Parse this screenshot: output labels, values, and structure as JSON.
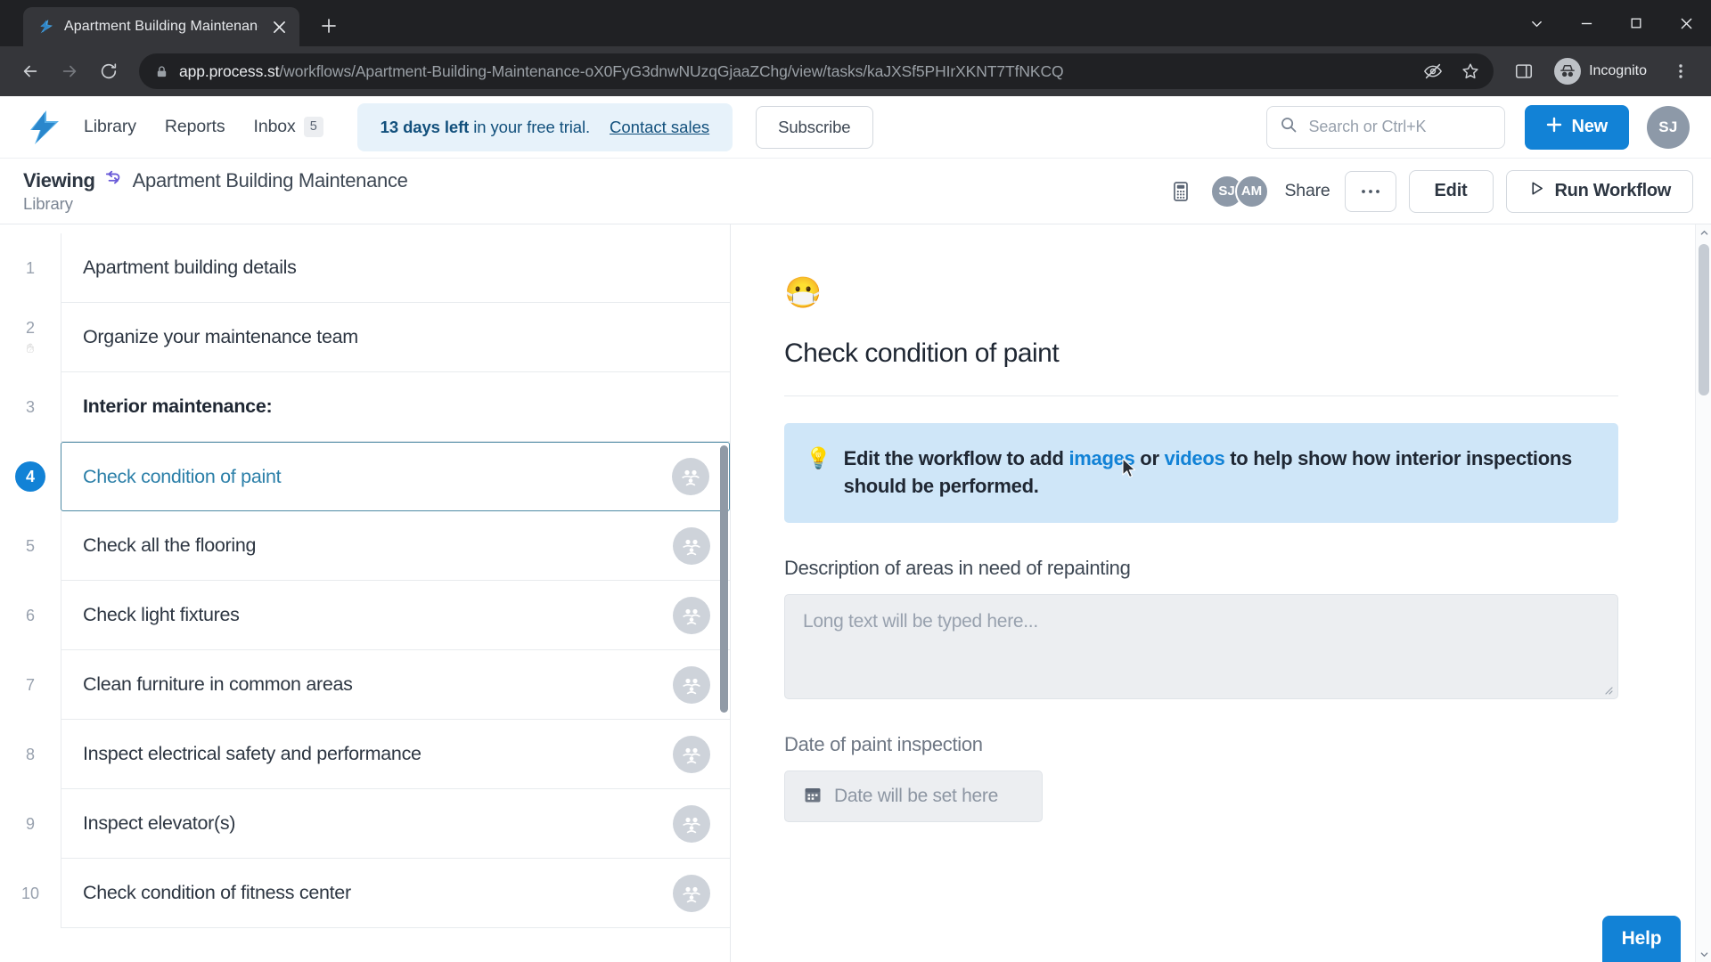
{
  "browser": {
    "tab": {
      "title": "Apartment Building Maintenance",
      "favicon_icon": "process-st-logo-icon",
      "close_icon": "close-icon"
    },
    "new_tab_icon": "plus-icon",
    "window_controls": [
      {
        "name": "minimize-to-tray-button",
        "icon": "chevron-down-icon"
      },
      {
        "name": "minimize-button",
        "icon": "minimize-icon"
      },
      {
        "name": "maximize-button",
        "icon": "maximize-icon"
      },
      {
        "name": "close-window-button",
        "icon": "close-icon"
      }
    ],
    "toolbar": {
      "back_icon": "back-arrow-icon",
      "forward_icon": "forward-arrow-icon",
      "reload_icon": "reload-icon",
      "lock_icon": "lock-icon",
      "url_domain": "app.process.st",
      "url_path": "/workflows/Apartment-Building-Maintenance-oX0FyG3dnwNUzqGjaaZChg/view/tasks/kaJXSf5PHIrXKNT7TfNKCQ",
      "tracking_protection_icon": "eye-slash-icon",
      "bookmark_icon": "star-icon",
      "side_panel_icon": "side-panel-icon",
      "profile_label": "Incognito",
      "profile_icon": "incognito-icon",
      "menu_icon": "three-dots-vertical-icon"
    }
  },
  "app_header": {
    "logo_icon": "process-st-logo-icon",
    "nav": [
      {
        "label": "Library",
        "badge": null
      },
      {
        "label": "Reports",
        "badge": null
      },
      {
        "label": "Inbox",
        "badge": "5"
      }
    ],
    "trial": {
      "days_bold": "13 days left",
      "rest": " in your free trial.",
      "link": "Contact sales"
    },
    "subscribe_label": "Subscribe",
    "search": {
      "placeholder": "Search or Ctrl+K",
      "icon": "search-icon"
    },
    "new_button": {
      "label": "New",
      "icon": "plus-icon"
    },
    "avatar": {
      "initials": "SJ"
    }
  },
  "sub_header": {
    "mode_label": "Viewing",
    "workflow_icon": "workflow-icon",
    "workflow_name": "Apartment Building Maintenance",
    "breadcrumb_parent": "Library",
    "calculator_icon": "calculator-icon",
    "avatars": [
      {
        "initials": "SJ"
      },
      {
        "initials": "AM"
      }
    ],
    "share_label": "Share",
    "more_label": "···",
    "edit_label": "Edit",
    "run_label": "Run Workflow",
    "run_icon": "play-icon"
  },
  "task_list": [
    {
      "number": "1",
      "label": "Apartment building details",
      "type": "task",
      "selected": false,
      "assignee_icon": null
    },
    {
      "number": "2",
      "label": "Organize your maintenance team",
      "type": "task",
      "selected": false,
      "assignee_icon": null,
      "drag_icon": "hand-icon"
    },
    {
      "number": "3",
      "label": "Interior maintenance:",
      "type": "heading",
      "selected": false,
      "assignee_icon": null
    },
    {
      "number": "4",
      "label": "Check condition of paint",
      "type": "task",
      "selected": true,
      "assignee_icon": "assign-group-icon"
    },
    {
      "number": "5",
      "label": "Check all the flooring",
      "type": "task",
      "selected": false,
      "assignee_icon": "assign-group-icon"
    },
    {
      "number": "6",
      "label": "Check light fixtures",
      "type": "task",
      "selected": false,
      "assignee_icon": "assign-group-icon"
    },
    {
      "number": "7",
      "label": "Clean furniture in common areas",
      "type": "task",
      "selected": false,
      "assignee_icon": "assign-group-icon"
    },
    {
      "number": "8",
      "label": "Inspect electrical safety and performance",
      "type": "task",
      "selected": false,
      "assignee_icon": "assign-group-icon"
    },
    {
      "number": "9",
      "label": "Inspect elevator(s)",
      "type": "task",
      "selected": false,
      "assignee_icon": "assign-group-icon"
    },
    {
      "number": "10",
      "label": "Check condition of fitness center",
      "type": "task",
      "selected": false,
      "assignee_icon": "assign-group-icon"
    }
  ],
  "detail": {
    "emoji": "😷",
    "emoji_icon": "face-with-medical-mask-icon",
    "title": "Check condition of paint",
    "tip": {
      "bulb_icon": "lightbulb-icon",
      "part1": "Edit the workflow to add ",
      "link1": "images",
      "part2": " or ",
      "link2": "videos",
      "part3": " to help show how interior inspections should be performed."
    },
    "fields": [
      {
        "label": "Description of areas in need of repainting",
        "type": "textarea",
        "value": "",
        "placeholder": "Long text will be typed here..."
      },
      {
        "label": "Date of paint inspection",
        "type": "date",
        "value": "",
        "placeholder": "Date will be set here",
        "icon": "calendar-icon"
      }
    ]
  },
  "help_button": {
    "label": "Help"
  },
  "colors": {
    "accent_blue": "#1282d6",
    "tip_bg": "#cfe6f8",
    "banner_bg": "#e7f2fa",
    "selected_border": "#4e8aa4",
    "chrome_dark": "#35363a"
  }
}
